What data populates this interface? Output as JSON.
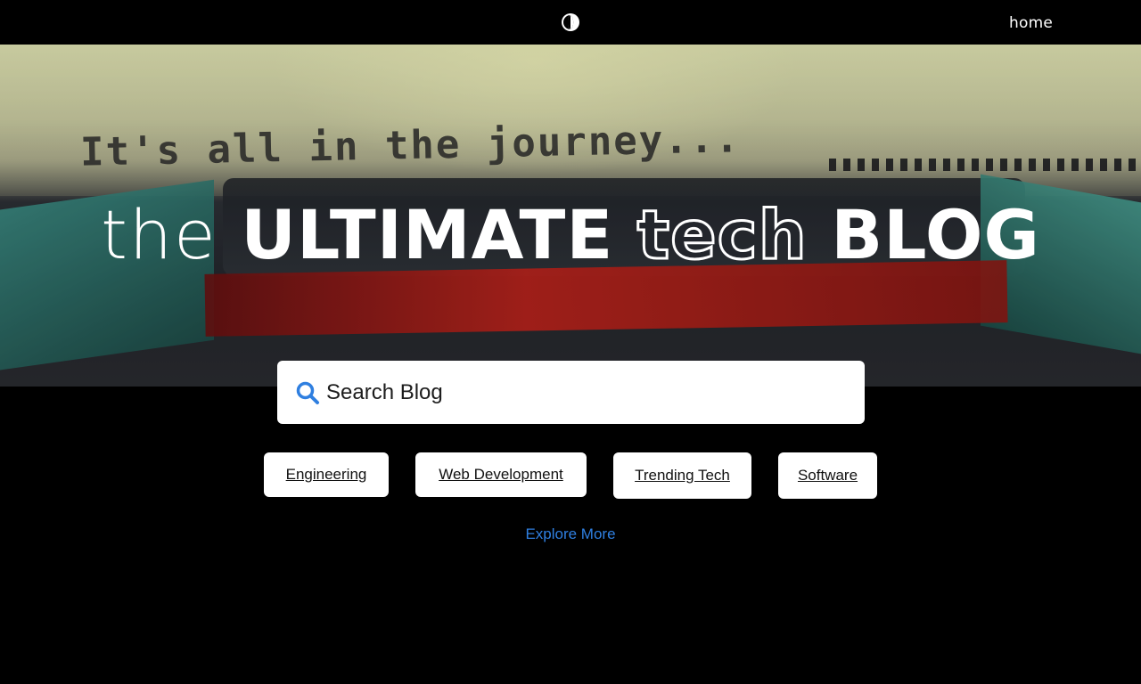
{
  "nav": {
    "home_label": "home",
    "logo_icon": "half-circle-icon"
  },
  "hero": {
    "background_text": "It's all in the journey...",
    "headline": {
      "part1": "the",
      "part2": "ULTIMATE",
      "part3": "tech",
      "part4": "BLOG"
    }
  },
  "search": {
    "placeholder": "Search Blog",
    "value": "",
    "icon": "search-icon",
    "icon_color": "#2f7fe0"
  },
  "categories": [
    "Engineering",
    "Web Development",
    "Trending Tech",
    "Software"
  ],
  "explore_label": "Explore More",
  "colors": {
    "background": "#000000",
    "accent": "#2f7fe0",
    "tag_bg": "#ffffff"
  }
}
